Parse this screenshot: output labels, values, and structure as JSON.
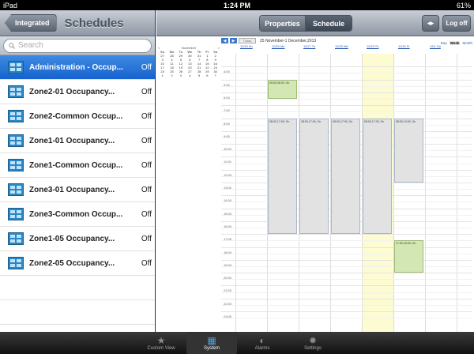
{
  "status": {
    "device": "iPad",
    "time": "1:24 PM",
    "battery": "61%"
  },
  "left": {
    "back_label": "Integrated",
    "title": "Schedules",
    "search_placeholder": "Search",
    "items": [
      {
        "label": "Administration - Occup...",
        "state": "Off",
        "selected": true
      },
      {
        "label": "Zone2-01 Occupancy...",
        "state": "Off"
      },
      {
        "label": "Zone2-Common Occup...",
        "state": "Off"
      },
      {
        "label": "Zone1-01 Occupancy...",
        "state": "Off"
      },
      {
        "label": "Zone1-Common Occup...",
        "state": "Off"
      },
      {
        "label": "Zone3-01 Occupancy...",
        "state": "Off"
      },
      {
        "label": "Zone3-Common Occup...",
        "state": "Off"
      },
      {
        "label": "Zone1-05 Occupancy...",
        "state": "Off"
      },
      {
        "label": "Zone2-05 Occupancy...",
        "state": "Off"
      }
    ]
  },
  "right": {
    "seg_properties": "Properties",
    "seg_schedule": "Schedule",
    "arrows_label": "◂▸",
    "logoff_label": "Log off"
  },
  "calendar": {
    "prev": "◀",
    "next": "▶",
    "today": "Today",
    "range": "25 November-1 December,2013",
    "views": [
      "Day",
      "Week",
      "Month"
    ],
    "active_view": "Week",
    "mini_month": "November",
    "mini_prev": "<",
    "mini_next": ">",
    "mini_days": [
      "Su",
      "Mo",
      "Tu",
      "We",
      "Th",
      "Fr",
      "Sa"
    ],
    "mini_weeks": [
      [
        "27",
        "28",
        "29",
        "30",
        "31",
        "1",
        "2"
      ],
      [
        "3",
        "4",
        "5",
        "6",
        "7",
        "8",
        "9"
      ],
      [
        "10",
        "11",
        "12",
        "13",
        "14",
        "15",
        "16"
      ],
      [
        "17",
        "18",
        "19",
        "20",
        "21",
        "22",
        "23"
      ],
      [
        "24",
        "25",
        "26",
        "27",
        "28",
        "29",
        "30"
      ],
      [
        "1",
        "2",
        "3",
        "4",
        "5",
        "6",
        "7"
      ]
    ],
    "day_headers": [
      "11/25 Su",
      "11/26 Mo",
      "11/27 Tu",
      "11/28 We",
      "11/29 Th",
      "11/30 Fr",
      "12/1 Sa"
    ],
    "hours": [
      "4:00",
      "5:00",
      "6:00",
      "7:00",
      "8:00",
      "9:00",
      "10:00",
      "11:00",
      "12:00",
      "13:00",
      "14:00",
      "15:00",
      "16:00",
      "17:00",
      "18:00",
      "19:00",
      "20:00",
      "21:00",
      "22:00",
      "23:00"
    ],
    "events": [
      {
        "day": 1,
        "start": 5.0,
        "end": 6.5,
        "label": "05:00-06:30, On",
        "color": "g"
      },
      {
        "day": 1,
        "start": 8.0,
        "end": 17.0,
        "label": "08:00-17:00, On",
        "color": "gr"
      },
      {
        "day": 2,
        "start": 8.0,
        "end": 17.0,
        "label": "08:00-17:00, On",
        "color": "gr"
      },
      {
        "day": 3,
        "start": 8.0,
        "end": 17.0,
        "label": "08:00-17:00, On",
        "color": "gr"
      },
      {
        "day": 4,
        "start": 8.0,
        "end": 17.0,
        "label": "08:00-17:00, On",
        "color": "gr"
      },
      {
        "day": 5,
        "start": 8.0,
        "end": 13.0,
        "label": "08:00-13:00, On",
        "color": "gr"
      },
      {
        "day": 5,
        "start": 17.5,
        "end": 20.0,
        "label": "17:30-20:00, On",
        "color": "g"
      }
    ],
    "today_day": 4
  },
  "tabs": [
    {
      "label": "Custom View",
      "icon": "star-icon"
    },
    {
      "label": "System",
      "icon": "building-icon",
      "active": true
    },
    {
      "label": "Alarms",
      "icon": "bell-icon"
    },
    {
      "label": "Settings",
      "icon": "gear-icon"
    }
  ]
}
